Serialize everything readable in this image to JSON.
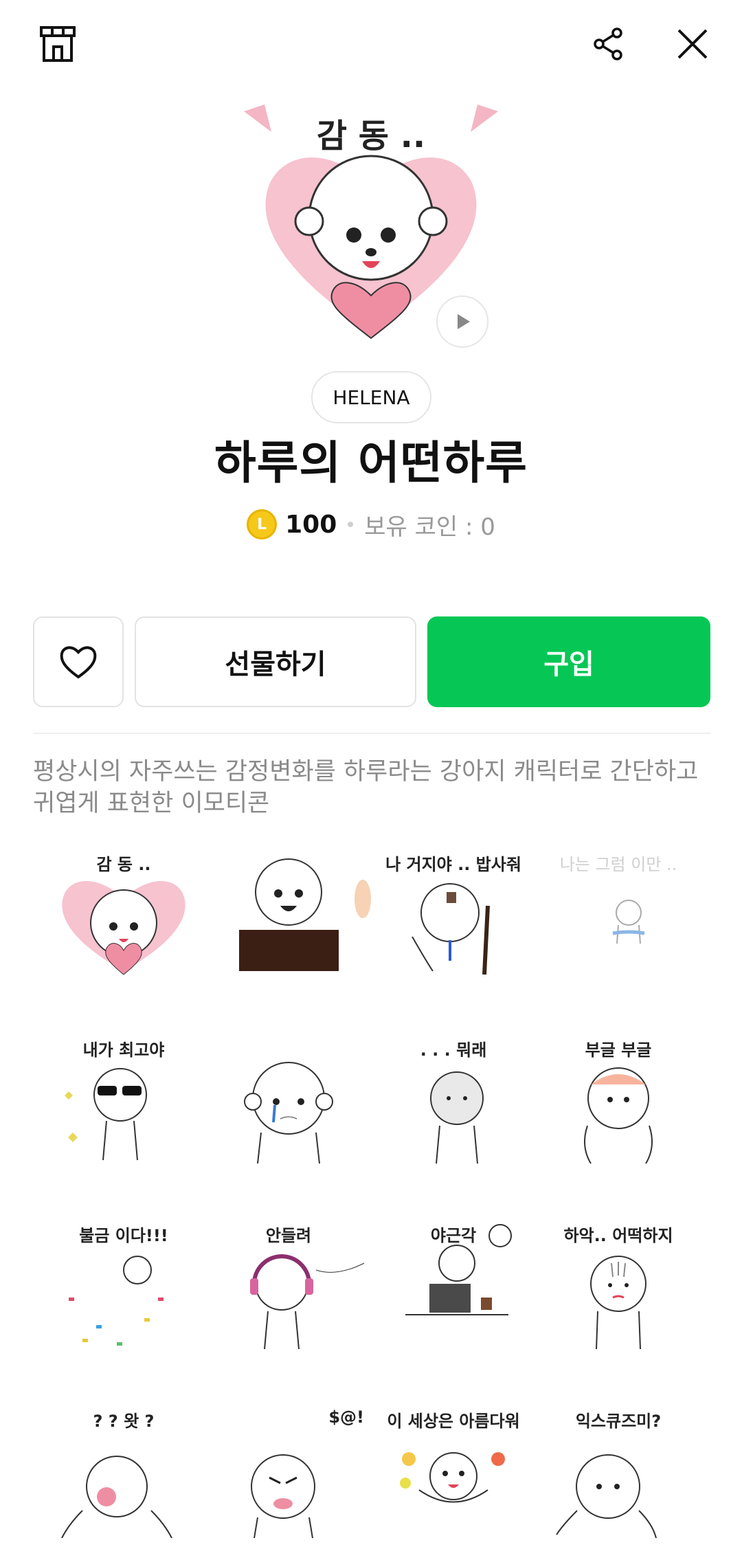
{
  "topbar": {
    "shop_icon": "shop-icon",
    "share_icon": "share-icon",
    "close_icon": "close-icon"
  },
  "hero": {
    "caption": "감 동 ..",
    "play_icon": "play-icon"
  },
  "product": {
    "author": "HELENA",
    "title": "하루의 어떤하루",
    "coin_letter": "L",
    "price": "100",
    "owned": "보유 코인 : 0"
  },
  "actions": {
    "like_icon": "heart-outline-icon",
    "gift_label": "선물하기",
    "buy_label": "구입"
  },
  "description": "평상시의 자주쓰는 감정변화를 하루라는 강아지 캐릭터로 간단하고 귀엽게 표현한 이모티콘",
  "stickers": [
    {
      "label": "감 동 .."
    },
    {
      "label": ""
    },
    {
      "label": "나 거지야 .. 밥사줘"
    },
    {
      "label": "나는 그럼 이만 .."
    },
    {
      "label": "내가 최고야"
    },
    {
      "label": ""
    },
    {
      "label": ". . . 뭐래"
    },
    {
      "label": "부글 부글"
    },
    {
      "label": "불금 이다!!!"
    },
    {
      "label": "안들려"
    },
    {
      "label": "야근각"
    },
    {
      "label": "하악.. 어떡하지"
    },
    {
      "label": "? ? 왓 ?"
    },
    {
      "label": "$@!"
    },
    {
      "label": "이 세상은 아름다워"
    },
    {
      "label": "익스큐즈미?"
    }
  ],
  "colors": {
    "buy_green": "#06c755",
    "coin_yellow": "#f6c81a",
    "heart_pink": "#f4b6c4"
  }
}
